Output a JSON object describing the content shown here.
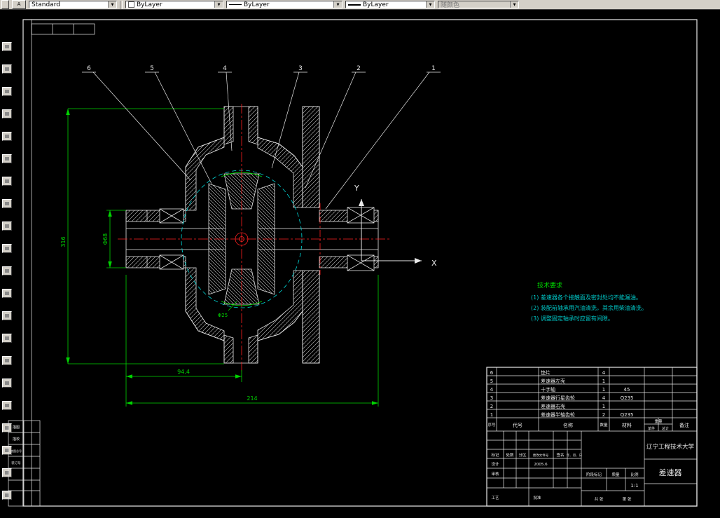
{
  "toolbar": {
    "style_combo": {
      "value": "Standard"
    },
    "color_combo": {
      "value": "ByLayer"
    },
    "linetype_combo": {
      "value": "ByLayer"
    },
    "lineweight_combo": {
      "value": "ByLayer"
    },
    "plotstyle_combo": {
      "value": "随颜色"
    }
  },
  "left_toolbar": {
    "count": 21
  },
  "canvas": {
    "callouts": [
      "6",
      "5",
      "4",
      "3",
      "2",
      "1"
    ],
    "ucs": {
      "x": "X",
      "y": "Y"
    },
    "dims": {
      "overall_height": "316",
      "shaft_dia": "Φ68",
      "half_length": "94.4",
      "overall_length": "214",
      "note": "Φ25"
    },
    "tech": {
      "title": "技术要求",
      "items": [
        "(1) 差速器各个接触面及密封处均不能漏油。",
        "(2) 装配前轴承用汽油清洗，其余用柴油清洗。",
        "(3) 调整固定轴承时应留有间隙。"
      ]
    }
  },
  "bom": {
    "headers": {
      "no": "序号",
      "code": "代号",
      "name": "名称",
      "qty": "数量",
      "material": "材料",
      "weight": "重量",
      "weight_unit": "单件",
      "weight_total": "总计",
      "remark": "备注"
    },
    "rows": [
      {
        "no": "6",
        "name": "垫片",
        "qty": "4",
        "material": ""
      },
      {
        "no": "5",
        "name": "差速器左壳",
        "qty": "1",
        "material": ""
      },
      {
        "no": "4",
        "name": "十字轴",
        "qty": "1",
        "material": "45"
      },
      {
        "no": "3",
        "name": "差速器行星齿轮",
        "qty": "4",
        "material": "Q235"
      },
      {
        "no": "2",
        "name": "差速器右壳",
        "qty": "1",
        "material": ""
      },
      {
        "no": "1",
        "name": "差速器半轴齿轮",
        "qty": "2",
        "material": "Q235"
      }
    ]
  },
  "titleblock": {
    "org": "辽宁工程技术大学",
    "title": "差速器",
    "labels": {
      "mark": "标记",
      "count": "处数",
      "zone": "分区",
      "doc_no": "更改文件号",
      "sign": "签名",
      "date": "年、月、日",
      "design": "设计",
      "check": "审核",
      "process": "工艺",
      "approve": "批准",
      "stage": "阶段标记",
      "mass": "质量",
      "scale": "比例",
      "sheets": "共 张",
      "sheet": "第 张"
    },
    "values": {
      "design_date": "2005.6",
      "scale": "1:1"
    }
  },
  "border_table": {
    "rows": [
      "描图",
      "描校",
      "底图总号",
      "装订号"
    ]
  }
}
